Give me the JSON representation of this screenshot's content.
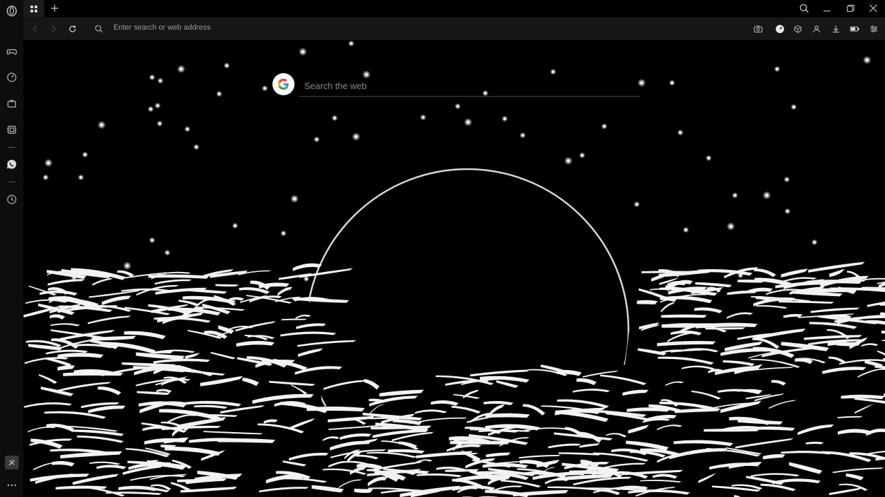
{
  "browser": {
    "address_placeholder": "Enter search or web address"
  },
  "search": {
    "placeholder": "Search the web",
    "engine_icon": "google-icon"
  },
  "sidebar": {
    "items": [
      {
        "icon": "opera-logo-icon"
      },
      {
        "icon": "gamepad-icon"
      },
      {
        "icon": "speedometer-icon"
      },
      {
        "icon": "briefcase-icon"
      },
      {
        "icon": "chip-icon"
      },
      {
        "icon": "whatsapp-icon"
      },
      {
        "icon": "history-icon"
      },
      {
        "icon": "settings-tool-icon"
      },
      {
        "icon": "more-icon"
      }
    ]
  },
  "colors": {
    "background": "#000000",
    "toolbar": "#161616",
    "sidebar": "#0d0d0d"
  }
}
